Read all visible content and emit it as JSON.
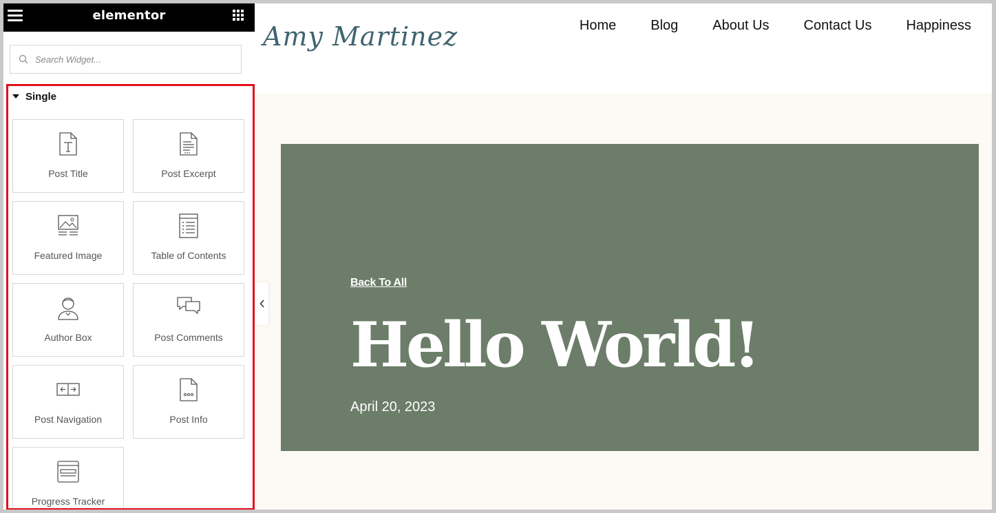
{
  "app": {
    "logo": "elementor"
  },
  "sidebar": {
    "search_placeholder": "Search Widget...",
    "category": "Single",
    "widgets": [
      {
        "label": "Post Title",
        "icon": "post-title-icon"
      },
      {
        "label": "Post Excerpt",
        "icon": "post-excerpt-icon"
      },
      {
        "label": "Featured Image",
        "icon": "featured-image-icon"
      },
      {
        "label": "Table of Contents",
        "icon": "table-of-contents-icon"
      },
      {
        "label": "Author Box",
        "icon": "author-box-icon"
      },
      {
        "label": "Post Comments",
        "icon": "post-comments-icon"
      },
      {
        "label": "Post Navigation",
        "icon": "post-navigation-icon"
      },
      {
        "label": "Post Info",
        "icon": "post-info-icon"
      },
      {
        "label": "Progress Tracker",
        "icon": "progress-tracker-icon"
      }
    ]
  },
  "site": {
    "brand": "Amy Martinez",
    "nav": [
      "Home",
      "Blog",
      "About Us",
      "Contact Us",
      "Happiness"
    ],
    "hero": {
      "back_link": "Back To All",
      "title": "Hello World!",
      "date": "April 20, 2023",
      "bg_color": "#6c7d69"
    }
  },
  "colors": {
    "highlight": "#e3101b",
    "topbar": "#000000",
    "page_bg": "#fdf9f5"
  }
}
